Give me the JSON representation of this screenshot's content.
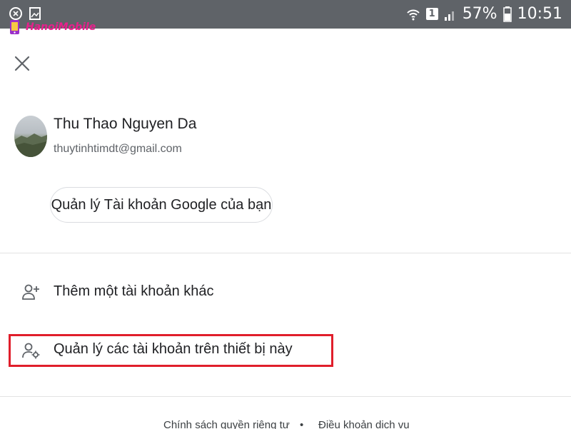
{
  "status_bar": {
    "battery": "57%",
    "time": "10:51",
    "sim_slot": "1"
  },
  "brand": {
    "name": "HanoiMobile"
  },
  "account": {
    "name": "Thu Thao Nguyen Da",
    "email": "thuytinhtimdt@gmail.com",
    "manage_button": "Quản lý Tài khoản Google của bạn"
  },
  "menu": {
    "add_account": "Thêm một tài khoản khác",
    "manage_accounts": "Quản lý các tài khoản trên thiết bị này"
  },
  "footer": {
    "privacy": "Chính sách quyền riêng tư",
    "separator": "•",
    "terms": "Điều khoản dịch vụ"
  },
  "colors": {
    "highlight": "#e01e2b",
    "status_bar": "#5f6368",
    "brand": "#e91e8c"
  }
}
